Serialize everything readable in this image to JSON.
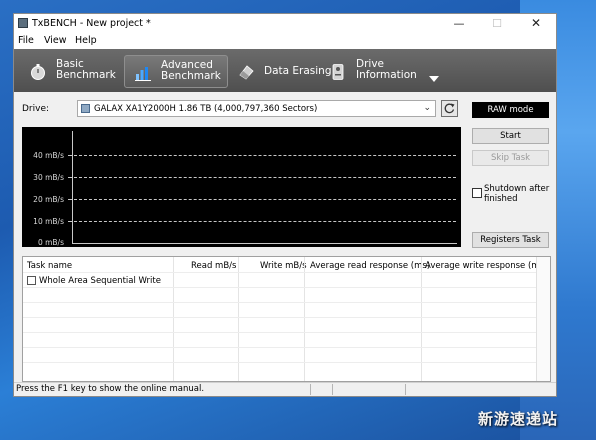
{
  "window": {
    "title": "TxBENCH - New project *"
  },
  "window_controls": {
    "minimize": "—",
    "maximize": "☐",
    "close": "✕"
  },
  "menu": [
    "File",
    "View",
    "Help"
  ],
  "toolbar": {
    "tabs": [
      {
        "label_line1": "Basic",
        "label_line2": "Benchmark",
        "icon": "stopwatch-icon",
        "active": false
      },
      {
        "label_line1": "Advanced",
        "label_line2": "Benchmark",
        "icon": "bar-chart-icon",
        "active": true
      },
      {
        "label_line1": "Data Erasing",
        "label_line2": "",
        "icon": "eraser-icon",
        "active": false
      },
      {
        "label_line1": "Drive",
        "label_line2": "Information",
        "icon": "drive-info-icon",
        "active": false
      }
    ],
    "more_icon": "triangle-down-icon"
  },
  "drive": {
    "label": "Drive:",
    "selected": "GALAX XA1Y2000H  1.86 TB (4,000,797,360 Sectors)"
  },
  "raw_mode": "RAW mode",
  "graph": {
    "y_ticks": [
      "40 mB/s",
      "30 mB/s",
      "20 mB/s",
      "10 mB/s",
      "0 mB/s"
    ],
    "y_values": [
      40,
      30,
      20,
      10,
      0
    ]
  },
  "buttons": {
    "start": "Start",
    "skip_task": "Skip Task",
    "registers_task": "Registers Task"
  },
  "shutdown": {
    "label": "Shutdown after finished",
    "checked": false
  },
  "task_table": {
    "columns": [
      "Task name",
      "Read mB/s",
      "Write mB/s",
      "Average read response (ms)",
      "Average write response (ms)"
    ],
    "rows": [
      {
        "name": "Whole Area Sequential Write",
        "checked": false
      }
    ]
  },
  "status": {
    "text": "Press the F1 key to show the online manual."
  },
  "watermark": "新游速递站",
  "colors": {
    "toolbar": "#585858",
    "graph_bg": "#000000",
    "raw_mode_bg": "#000000"
  }
}
